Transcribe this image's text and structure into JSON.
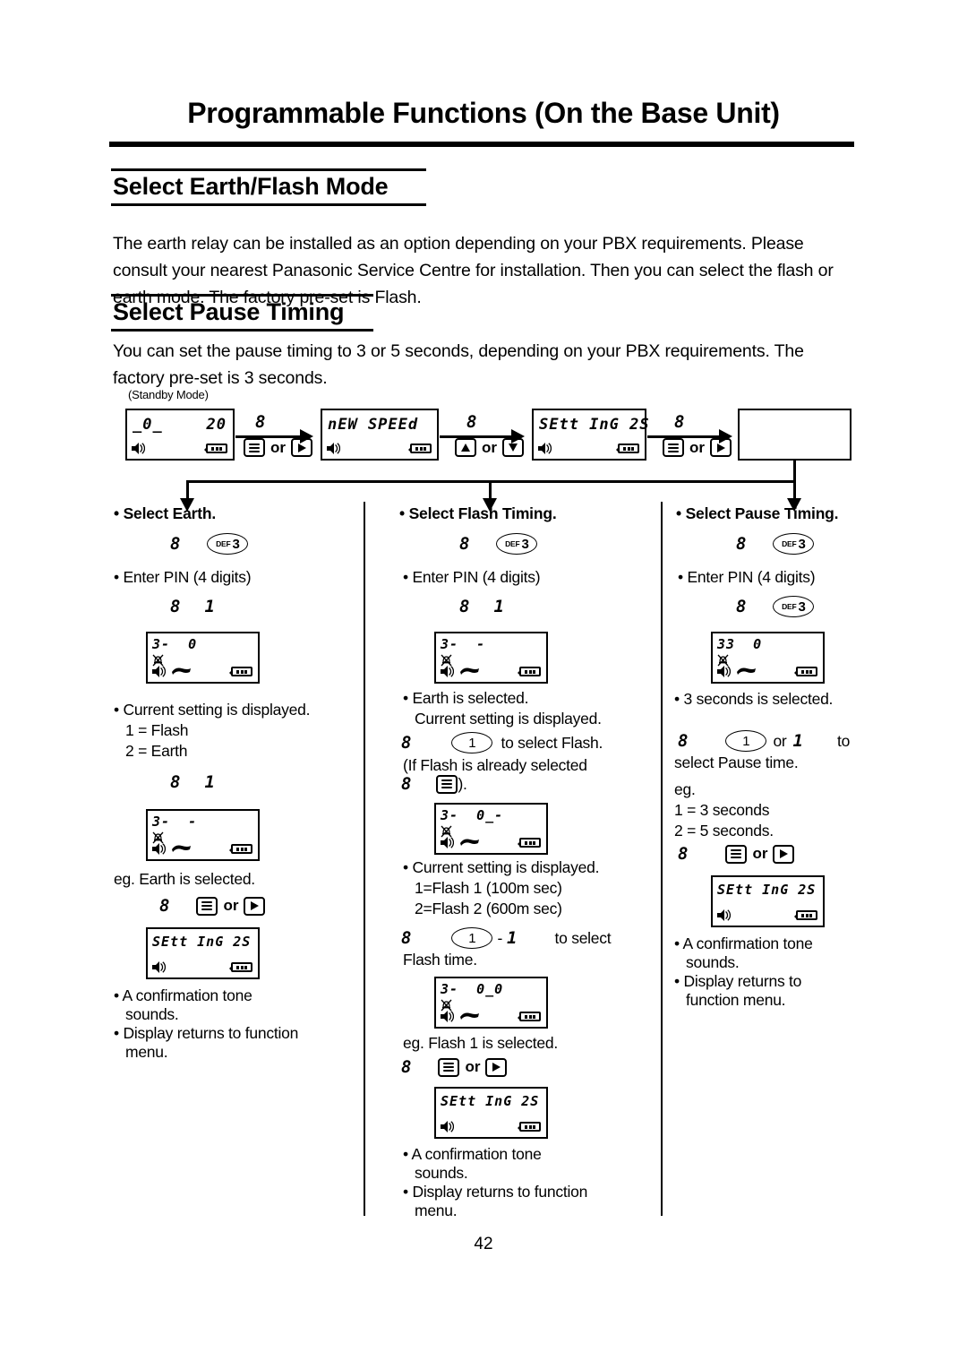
{
  "document": {
    "title": "Programmable Functions (On the Base Unit)",
    "page_number": "42"
  },
  "sections": [
    {
      "heading": "Select Earth/Flash Mode",
      "body": "The earth relay can be installed as an option depending on your PBX requirements. Please consult your nearest Panasonic Service Centre for installation. Then you can select the flash or earth mode. The factory pre-set is Flash."
    },
    {
      "heading": "Select Pause Timing",
      "body": "You can set the pause timing to 3 or 5 seconds, depending on your PBX requirements. The factory pre-set is 3 seconds."
    }
  ],
  "flow": {
    "standby_label": "(Standby Mode)",
    "displays": [
      {
        "left": "_0_",
        "right": "20"
      },
      {
        "left": "nEW SPEEd",
        "right": ""
      },
      {
        "left": "SEtt InG 2S",
        "right": ""
      },
      {
        "left": "",
        "right": ""
      }
    ],
    "steps": [
      {
        "marker": "8",
        "keys": "menu-icon or right-arrow-icon",
        "or_label": "or"
      },
      {
        "marker": "8",
        "keys": "up-arrow-icon or down-arrow-icon",
        "or_label": "or"
      },
      {
        "marker": "8",
        "keys": "menu-icon or right-arrow-icon",
        "or_label": "or"
      }
    ]
  },
  "columns": [
    {
      "heading": "• Select Earth.",
      "key_step1": {
        "marker": "8",
        "key_letters": "DEF",
        "key_number": "3"
      },
      "pin_note": "• Enter PIN (4 digits)",
      "key_step2": {
        "marker": "8",
        "key_glyph": "1"
      },
      "lcd1": {
        "line1": "3-  0"
      },
      "note1": {
        "l1": "• Current setting is displayed.",
        "l2": "1 = Flash",
        "l3": "2 = Earth"
      },
      "key_step3": {
        "marker": "8",
        "key_glyph": "1"
      },
      "lcd2": {
        "line1": "3-  -"
      },
      "note2": "eg. Earth is selected.",
      "key_step4": {
        "marker": "8",
        "or_label": "or"
      },
      "lcd3": {
        "line1": "SEtt InG 2S"
      },
      "note3": {
        "l1": "• A confirmation tone",
        "l2": "sounds.",
        "l3": "• Display returns to function",
        "l4": "menu."
      }
    },
    {
      "heading": "• Select Flash Timing.",
      "key_step1": {
        "marker": "8",
        "key_letters": "DEF",
        "key_number": "3"
      },
      "pin_note": "• Enter PIN (4 digits)",
      "key_step2": {
        "marker": "8",
        "key_glyph": "1"
      },
      "lcd1": {
        "line1": "3-  -"
      },
      "note1": {
        "l1": "• Earth is selected.",
        "l2": "Current setting is displayed."
      },
      "key_step3": {
        "marker": "8",
        "key_number": "1",
        "trailing": "to select Flash."
      },
      "paren_l1": "(If Flash is already selected",
      "paren_marker": "8",
      "paren_tail": ").",
      "lcd2": {
        "line1": "3-  0_-"
      },
      "note2": {
        "l1": "• Current setting is displayed.",
        "l2": "1=Flash 1 (100m sec)",
        "l3": "2=Flash 2 (600m sec)"
      },
      "key_step4": {
        "marker": "8",
        "key_number": "1",
        "dash": "-",
        "key_glyph": "1",
        "trailing": "to select"
      },
      "key_step4_l2": "Flash time.",
      "lcd3": {
        "line1": "3-  0_0"
      },
      "note3": "eg. Flash 1 is selected.",
      "key_step5": {
        "marker": "8",
        "or_label": "or"
      },
      "lcd4": {
        "line1": "SEtt InG 2S"
      },
      "note4": {
        "l1": "• A confirmation tone",
        "l2": "sounds.",
        "l3": "• Display returns to function",
        "l4": "menu."
      }
    },
    {
      "heading": "• Select Pause Timing.",
      "key_step1": {
        "marker": "8",
        "key_letters": "DEF",
        "key_number": "3"
      },
      "pin_note": "• Enter PIN (4 digits)",
      "key_step2": {
        "marker": "8",
        "key_letters": "DEF",
        "key_number": "3"
      },
      "lcd1": {
        "line1": "33  0"
      },
      "note1": "• 3 seconds is selected.",
      "key_step3": {
        "marker": "8",
        "key_number": "1",
        "or_label": "or",
        "key_glyph": "1",
        "trailing": "to"
      },
      "key_step3_l2": "select Pause time.",
      "note2": {
        "l1": "eg.",
        "l2": "1 = 3 seconds",
        "l3": "2 = 5 seconds."
      },
      "key_step4": {
        "marker": "8",
        "or_label": "or"
      },
      "lcd2": {
        "line1": "SEtt InG 2S"
      },
      "note3": {
        "l1": "• A confirmation tone",
        "l2": "sounds.",
        "l3": "• Display returns to",
        "l4": "function menu."
      }
    }
  ]
}
